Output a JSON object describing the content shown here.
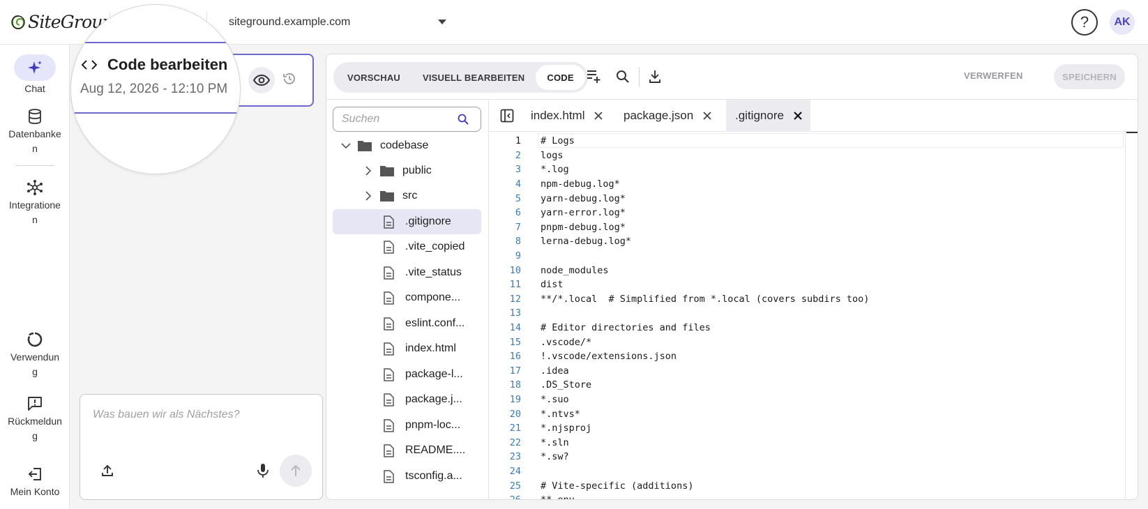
{
  "header": {
    "logo_text": "SiteGround",
    "site_selector": "siteground.example.com",
    "help_label": "?",
    "avatar_initials": "AK"
  },
  "nav": {
    "items": [
      {
        "label": "Chat",
        "icon": "sparkle-icon",
        "active": true
      },
      {
        "label": "Datenbanke\nn",
        "icon": "database-icon"
      },
      {
        "label": "Integratione\nn",
        "icon": "integrations-icon"
      },
      {
        "label": "Verwendun\ng",
        "icon": "usage-icon"
      },
      {
        "label": "Rückmeldun\ng",
        "icon": "feedback-icon"
      },
      {
        "label": "Mein Konto",
        "icon": "logout-icon"
      }
    ]
  },
  "chat_card": {
    "title": "Code bearbeiten",
    "date": "Aug 12, 2026 - 12:10 PM"
  },
  "prompt": {
    "placeholder": "Was bauen wir als Nächstes?"
  },
  "editor": {
    "modes": [
      {
        "label": "VORSCHAU",
        "active": false
      },
      {
        "label": "VISUELL BEARBEITEN",
        "active": false
      },
      {
        "label": "CODE",
        "active": true
      }
    ],
    "discard_label": "VERWERFEN",
    "save_label": "SPEICHERN",
    "search_placeholder": "Suchen",
    "tree": [
      {
        "name": "codebase",
        "type": "folder",
        "expanded": true
      },
      {
        "name": "public",
        "type": "folder"
      },
      {
        "name": "src",
        "type": "folder"
      },
      {
        "name": ".gitignore",
        "type": "file",
        "selected": true
      },
      {
        "name": ".vite_copied",
        "type": "file"
      },
      {
        "name": ".vite_status",
        "type": "file"
      },
      {
        "name": "compone...",
        "type": "file"
      },
      {
        "name": "eslint.conf...",
        "type": "file"
      },
      {
        "name": "index.html",
        "type": "file"
      },
      {
        "name": "package-l...",
        "type": "file"
      },
      {
        "name": "package.j...",
        "type": "file"
      },
      {
        "name": "pnpm-loc...",
        "type": "file"
      },
      {
        "name": "README....",
        "type": "file"
      },
      {
        "name": "tsconfig.a...",
        "type": "file"
      }
    ],
    "tabs": [
      {
        "name": "index.html",
        "active": false
      },
      {
        "name": "package.json",
        "active": false
      },
      {
        "name": ".gitignore",
        "active": true
      }
    ],
    "code": [
      "# Logs",
      "logs",
      "*.log",
      "npm-debug.log*",
      "yarn-debug.log*",
      "yarn-error.log*",
      "pnpm-debug.log*",
      "lerna-debug.log*",
      "",
      "node_modules",
      "dist",
      "**/*.local  # Simplified from *.local (covers subdirs too)",
      "",
      "# Editor directories and files",
      ".vscode/*",
      "!.vscode/extensions.json",
      ".idea",
      ".DS_Store",
      "*.suo",
      "*.ntvs*",
      "*.njsproj",
      "*.sln",
      "*.sw?",
      "",
      "# Vite-specific (additions)",
      "**.env"
    ]
  }
}
